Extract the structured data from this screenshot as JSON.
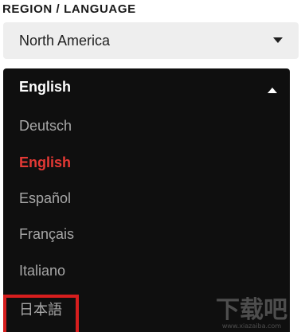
{
  "region": {
    "heading": "REGION / LANGUAGE",
    "selected": "North America"
  },
  "language": {
    "current": "English",
    "options": [
      {
        "label": "Deutsch",
        "selected": false
      },
      {
        "label": "English",
        "selected": true
      },
      {
        "label": "Español",
        "selected": false
      },
      {
        "label": "Français",
        "selected": false
      },
      {
        "label": "Italiano",
        "selected": false
      },
      {
        "label": "日本語",
        "selected": false
      }
    ],
    "active_color": "#e53935",
    "panel_color": "#0f0f0f"
  },
  "annotation": {
    "highlight_color": "#d71e1e"
  },
  "watermark": {
    "text": "下载吧",
    "subtext": "www.xiazaiba.com"
  },
  "icons": [
    "caret-down-icon",
    "caret-up-icon"
  ]
}
